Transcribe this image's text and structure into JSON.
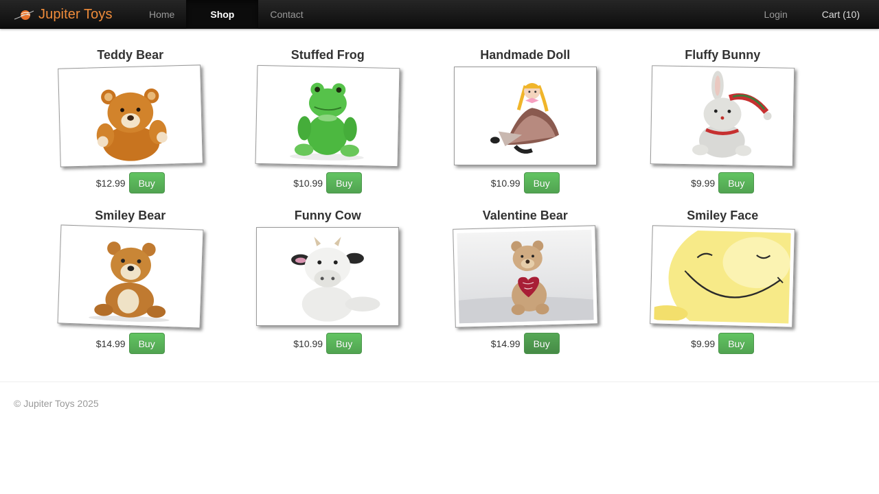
{
  "brand": {
    "name": "Jupiter Toys",
    "accent": "#f08c3a"
  },
  "nav": {
    "items": [
      {
        "label": "Home"
      },
      {
        "label": "Shop",
        "active": true
      },
      {
        "label": "Contact"
      }
    ],
    "login": "Login",
    "cart": "Cart (10)"
  },
  "products": [
    {
      "title": "Teddy Bear",
      "price": "$12.99",
      "buy": "Buy",
      "image": "teddy-bear-image"
    },
    {
      "title": "Stuffed Frog",
      "price": "$10.99",
      "buy": "Buy",
      "image": "stuffed-frog-image"
    },
    {
      "title": "Handmade Doll",
      "price": "$10.99",
      "buy": "Buy",
      "image": "handmade-doll-image"
    },
    {
      "title": "Fluffy Bunny",
      "price": "$9.99",
      "buy": "Buy",
      "image": "fluffy-bunny-image"
    },
    {
      "title": "Smiley Bear",
      "price": "$14.99",
      "buy": "Buy",
      "image": "smiley-bear-image"
    },
    {
      "title": "Funny Cow",
      "price": "$10.99",
      "buy": "Buy",
      "image": "funny-cow-image"
    },
    {
      "title": "Valentine Bear",
      "price": "$14.99",
      "buy": "Buy",
      "image": "valentine-bear-image"
    },
    {
      "title": "Smiley Face",
      "price": "$9.99",
      "buy": "Buy",
      "image": "smiley-face-image"
    }
  ],
  "buy_button_color": "#5bb75b",
  "footer": {
    "text": "© Jupiter Toys 2025"
  }
}
